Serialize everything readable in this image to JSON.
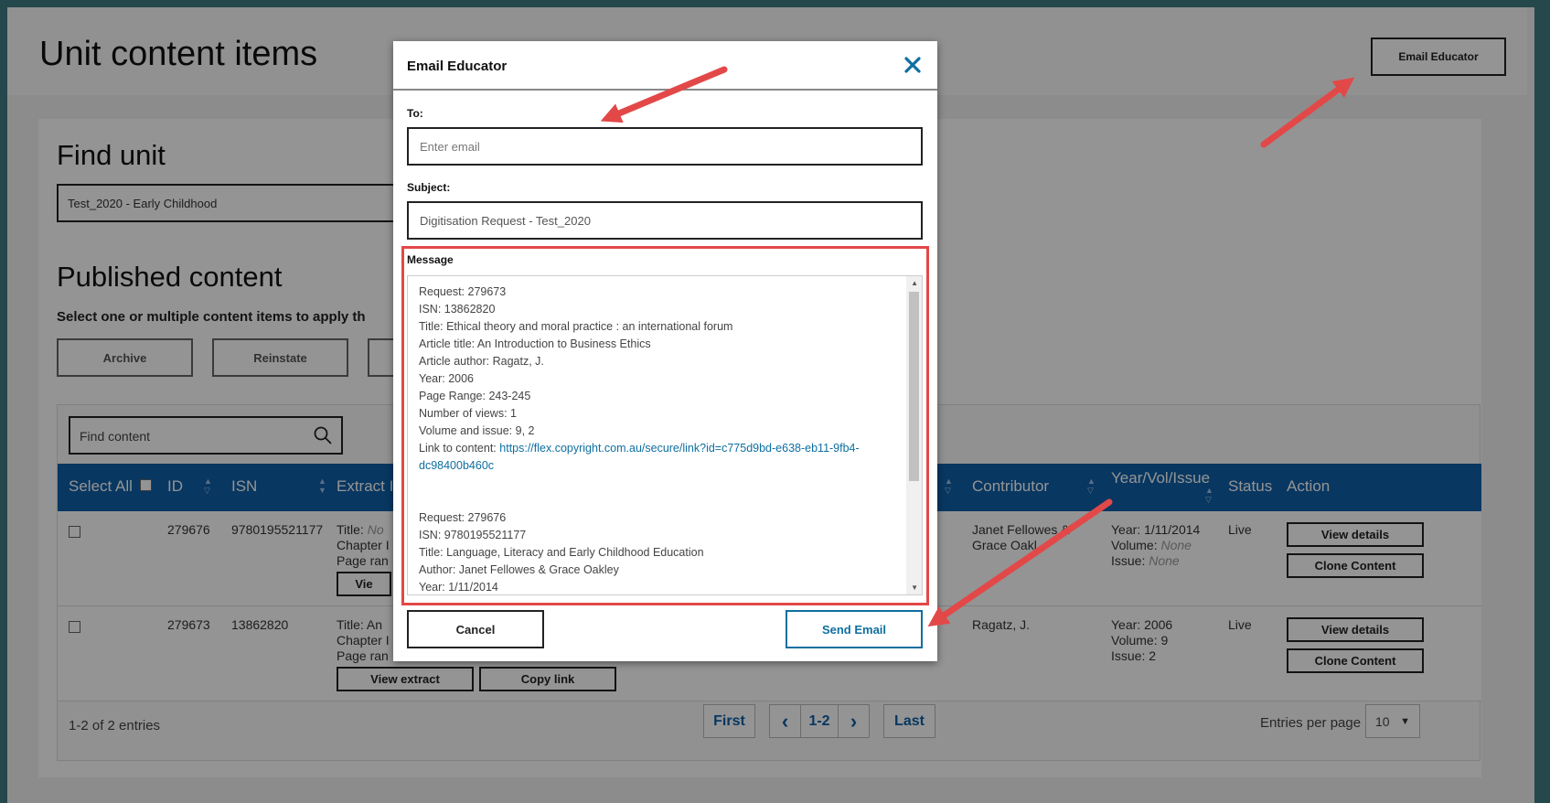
{
  "page": {
    "title": "Unit content items",
    "email_educator_button": "Email Educator"
  },
  "find_unit": {
    "title": "Find unit",
    "selected_unit": "Test_2020 - Early Childhood"
  },
  "published": {
    "title": "Published content",
    "subtitle": "Select one or multiple content items to apply th",
    "actions": [
      "Archive",
      "Reinstate"
    ]
  },
  "table": {
    "search_placeholder": "Find content",
    "headers": {
      "select_all": "Select All",
      "id": "ID",
      "isn": "ISN",
      "extract": "Extract I",
      "contributor": "Contributor",
      "year_vol_issue": "Year/Vol/Issue",
      "status": "Status",
      "action": "Action"
    },
    "rows": [
      {
        "id": "279676",
        "isn": "9780195521177",
        "extract_lines": [
          "Title: ",
          "Chapter I",
          "Page ran"
        ],
        "extract_title_value": "No",
        "extract_button": "Vie",
        "contributor": [
          "Janet Fellowes &",
          "Grace Oakl"
        ],
        "year": "Year: 1/11/2014",
        "volume_label": "Volume: ",
        "volume_value": "None",
        "issue_label": "Issue: ",
        "issue_value": "None",
        "status": "Live"
      },
      {
        "id": "279673",
        "isn": "13862820",
        "extract_lines": [
          "Title: An",
          "Chapter I",
          "Page ran"
        ],
        "view_extract_button": "View extract",
        "copy_link_button": "Copy link",
        "contributor": [
          "Ragatz, J."
        ],
        "year": "Year: 2006",
        "volume": "Volume: 9",
        "issue": "Issue: 2",
        "status": "Live"
      }
    ],
    "view_details_button": "View details",
    "clone_content_button": "Clone Content",
    "entries_count": "1-2 of 2 entries",
    "pager": {
      "first": "First",
      "prev": "‹",
      "current": "1-2",
      "next": "›",
      "last": "Last"
    },
    "entries_per_page_label": "Entries per page",
    "entries_per_page_value": "10"
  },
  "modal": {
    "title": "Email Educator",
    "to_label": "To:",
    "to_placeholder": "Enter email",
    "subject_label": "Subject:",
    "subject_value": "Digitisation Request - Test_2020",
    "message_label": "Message",
    "message_block1": [
      "Request: 279673",
      "ISN: 13862820",
      "Title: Ethical theory and moral practice : an international forum",
      "Article title: An Introduction to Business Ethics",
      "Article author: Ragatz, J.",
      "Year: 2006",
      "Page Range: 243-245",
      "Number of views: 1",
      "Volume and issue: 9, 2"
    ],
    "link_label": "Link to content: ",
    "link_url": "https://flex.copyright.com.au/secure/link?id=c775d9bd-e638-eb11-9fb4-dc98400b460c",
    "message_block2": [
      "Request: 279676",
      "ISN: 9780195521177",
      "Title: Language, Literacy and Early Childhood Education",
      "Author: Janet Fellowes & Grace Oakley",
      "Year: 1/11/2014"
    ],
    "cancel_button": "Cancel",
    "send_button": "Send Email"
  },
  "colors": {
    "brand_blue": "#0e5fa8",
    "link_teal": "#0e6fa0",
    "annotation_red": "#e34848",
    "frame_teal": "#3f7d82"
  }
}
